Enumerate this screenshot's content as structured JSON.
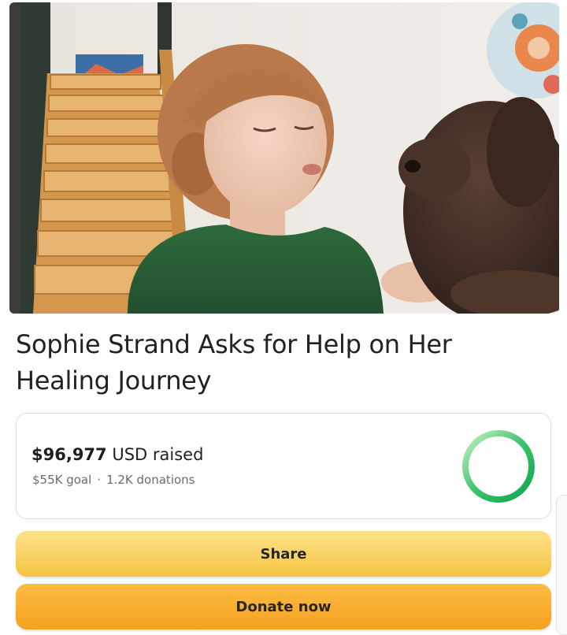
{
  "campaign": {
    "title": "Sophie Strand Asks for Help on Her Healing Journey",
    "hero_image": "photo-woman-with-dog",
    "raised_amount": "$96,977",
    "raised_suffix": " USD raised",
    "goal": "$55K goal",
    "separator": "·",
    "donations": "1.2K donations",
    "progress_fraction": 1.0
  },
  "actions": {
    "share_label": "Share",
    "donate_label": "Donate now"
  },
  "colors": {
    "share_button": "#f5c342",
    "donate_button": "#f5a21f",
    "progress_green": "#1fb35a",
    "progress_light": "#c8efc4"
  }
}
